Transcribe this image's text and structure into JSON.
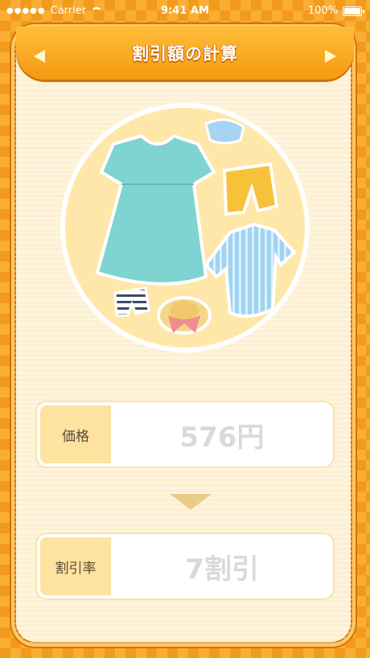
{
  "status_bar": {
    "carrier": "Carrier",
    "time": "9:41 AM",
    "battery": "100%"
  },
  "header": {
    "title": "割引額の計算"
  },
  "price_row": {
    "label": "価格",
    "value": "576円"
  },
  "discount_row": {
    "label": "割引率",
    "value": "7割引"
  },
  "colors": {
    "background": "#f29a1c",
    "card": "#fdf0d3",
    "header": "#f59a10",
    "label_bg": "#fde2a0",
    "value_text": "#d9d9d9"
  },
  "icons": {
    "header_left": "triangle-left-icon",
    "header_right": "triangle-right-icon",
    "connector": "triangle-down-icon"
  }
}
